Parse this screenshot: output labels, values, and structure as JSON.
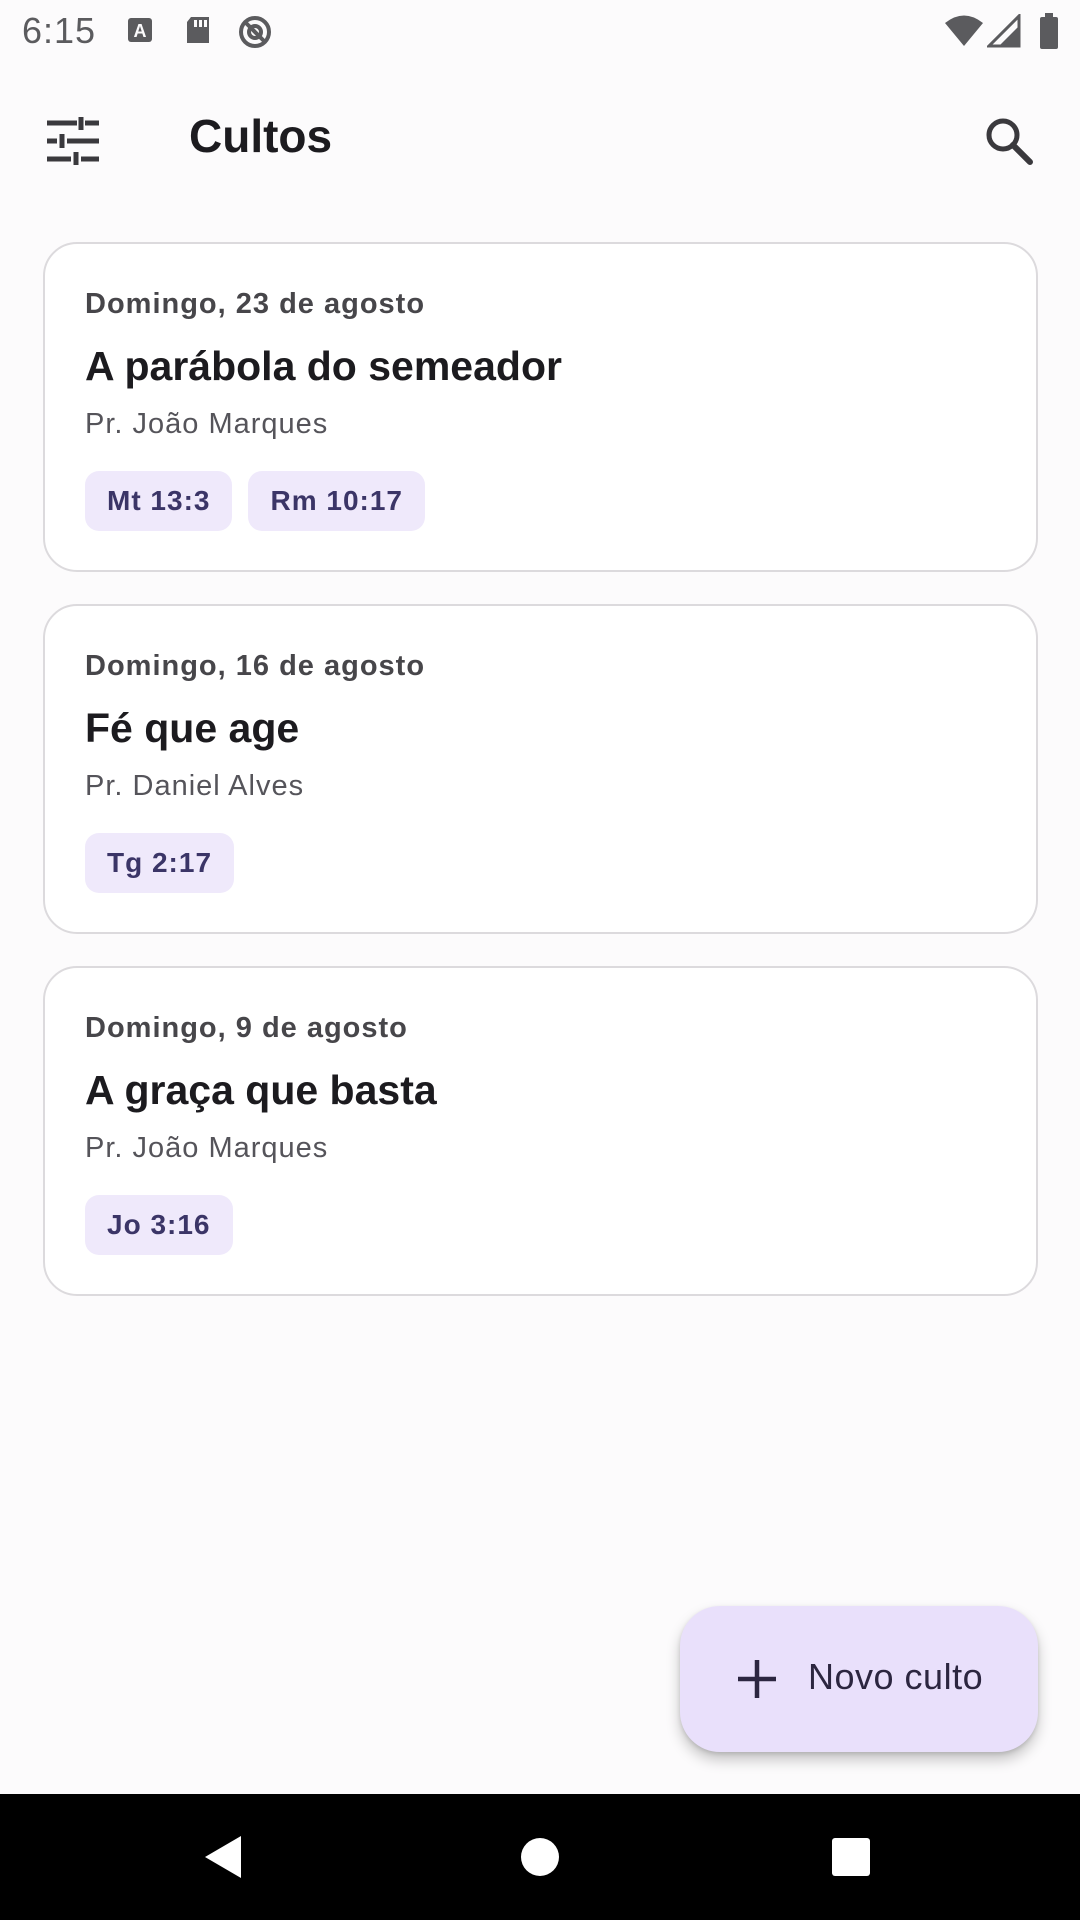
{
  "status_bar": {
    "time": "6:15",
    "left_icons": [
      "a-notification-icon",
      "sd-card-icon",
      "blocked-icon"
    ],
    "right_icons": [
      "wifi-icon",
      "signal-icon",
      "battery-icon"
    ]
  },
  "app_bar": {
    "title": "Cultos",
    "left_icon": "tune-filter-icon",
    "right_icon": "search-icon"
  },
  "cultos": [
    {
      "date": "Domingo, 23 de agosto",
      "title": "A parábola do semeador",
      "author": "Pr. João Marques",
      "refs": [
        "Mt 13:3",
        "Rm 10:17"
      ]
    },
    {
      "date": "Domingo, 16 de agosto",
      "title": "Fé que age",
      "author": "Pr. Daniel Alves",
      "refs": [
        "Tg 2:17"
      ]
    },
    {
      "date": "Domingo, 9 de agosto",
      "title": "A graça que basta",
      "author": "Pr. João Marques",
      "refs": [
        "Jo 3:16"
      ]
    }
  ],
  "fab": {
    "label": "Novo culto",
    "icon": "plus-icon"
  },
  "colors": {
    "background": "#fcfbfc",
    "card_border": "#dcdadd",
    "chip_bg": "#efe9fb",
    "chip_text": "#3b3567",
    "fab_bg": "#e9e0fb"
  },
  "nav_bar": {
    "icons": [
      "back-icon",
      "home-icon",
      "recents-icon"
    ]
  }
}
